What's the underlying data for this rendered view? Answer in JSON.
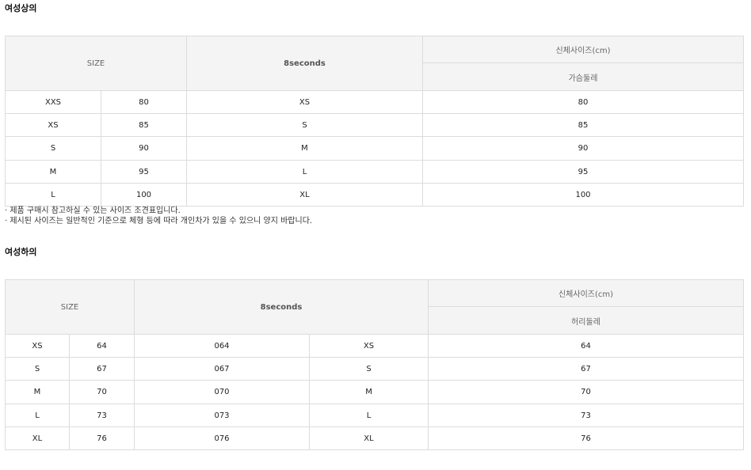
{
  "top": {
    "title": "여성상의",
    "headers": {
      "size": "SIZE",
      "brand": "8seconds",
      "body": "신체사이즈(cm)",
      "measure": "가슴둘레"
    },
    "rows": [
      {
        "size": "XXS",
        "num": "80",
        "brand": "XS",
        "measure": "80"
      },
      {
        "size": "XS",
        "num": "85",
        "brand": "S",
        "measure": "85"
      },
      {
        "size": "S",
        "num": "90",
        "brand": "M",
        "measure": "90"
      },
      {
        "size": "M",
        "num": "95",
        "brand": "L",
        "measure": "95"
      },
      {
        "size": "L",
        "num": "100",
        "brand": "XL",
        "measure": "100"
      }
    ],
    "notes": [
      "· 제품 구매시 참고하실 수 있는 사이즈 조견표입니다.",
      "· 제시된 사이즈는 일반적인 기준으로 체형 등에 따라 개인차가 있을 수 있으니 양지 바랍니다."
    ]
  },
  "bottom": {
    "title": "여성하의",
    "headers": {
      "size": "SIZE",
      "brand": "8seconds",
      "body": "신체사이즈(cm)",
      "measure": "허리둘레"
    },
    "rows": [
      {
        "size": "XS",
        "num": "64",
        "code": "064",
        "brand": "XS",
        "measure": "64"
      },
      {
        "size": "S",
        "num": "67",
        "code": "067",
        "brand": "S",
        "measure": "67"
      },
      {
        "size": "M",
        "num": "70",
        "code": "070",
        "brand": "M",
        "measure": "70"
      },
      {
        "size": "L",
        "num": "73",
        "code": "073",
        "brand": "L",
        "measure": "73"
      },
      {
        "size": "XL",
        "num": "76",
        "code": "076",
        "brand": "XL",
        "measure": "76"
      }
    ]
  }
}
